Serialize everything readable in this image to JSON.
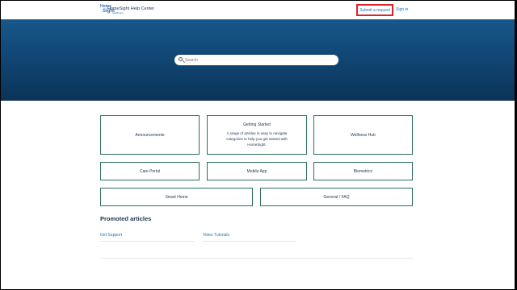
{
  "header": {
    "logo": {
      "line1": "Home",
      "line2": "Sight",
      "line3": "healthcare"
    },
    "site_title": "HomeSight Help Center",
    "submit_label": "Submit a request",
    "signin_label": "Sign in"
  },
  "search": {
    "placeholder": "Search"
  },
  "categories": {
    "announcements": "Announcements",
    "getting_started": {
      "title": "Getting Started",
      "description": "A range of articles in easy to navigate categories to help you get started with HomeSight."
    },
    "wellness_hub": "Wellness Hub",
    "care_portal": "Care Portal",
    "mobile_app": "Mobile App",
    "biometrics": "Biometrics",
    "smart_home": "Smart Home",
    "general_faq": "General / FAQ"
  },
  "promoted": {
    "title": "Promoted articles",
    "articles": [
      "Get Support",
      "Video Tutorials"
    ]
  },
  "colors": {
    "accent": "#1f73b7",
    "card_border": "#2e6d5e",
    "hero_top": "#17578b",
    "hero_bottom": "#0b3358",
    "highlight": "#e0202a"
  }
}
